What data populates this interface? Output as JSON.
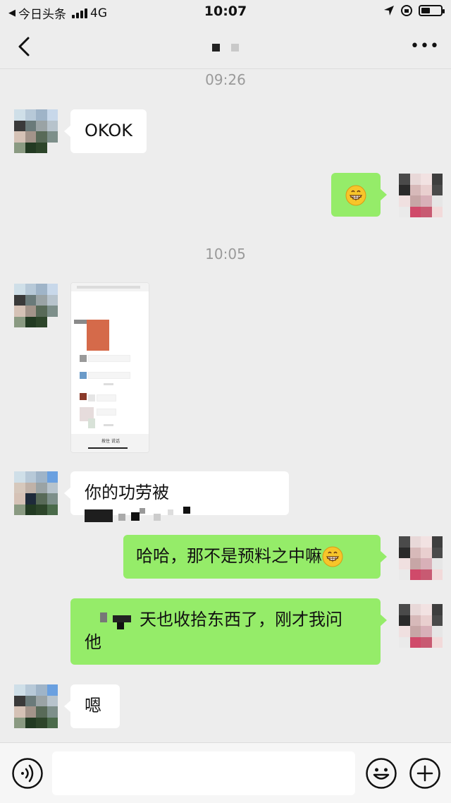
{
  "status_bar": {
    "back_app": "今日头条",
    "network": "4G",
    "time": "10:07"
  },
  "nav": {
    "more_label": "•••"
  },
  "chat": {
    "time_1": "09:26",
    "time_2": "10:05",
    "msg_okok": "OKOK",
    "msg_credit_prefix": "你的功劳被",
    "msg_haha": "哈哈，那不是预料之中嘛",
    "msg_pack_line1": "天也收拾东西了，刚才我问",
    "msg_pack_line2": "他",
    "msg_en": "嗯",
    "screenshot_caption": "按住 说话"
  },
  "input_bar": {
    "placeholder": ""
  },
  "colors": {
    "background": "#ededed",
    "bubble_self": "#95ec69",
    "bubble_other": "#ffffff",
    "timestamp": "#9a9a9a"
  },
  "icons": {
    "back": "chevron-left-icon",
    "more": "more-dots-icon",
    "voice": "voice-icon",
    "emoji": "smile-icon",
    "plus": "plus-icon",
    "grin": "grin-emoji-icon"
  }
}
